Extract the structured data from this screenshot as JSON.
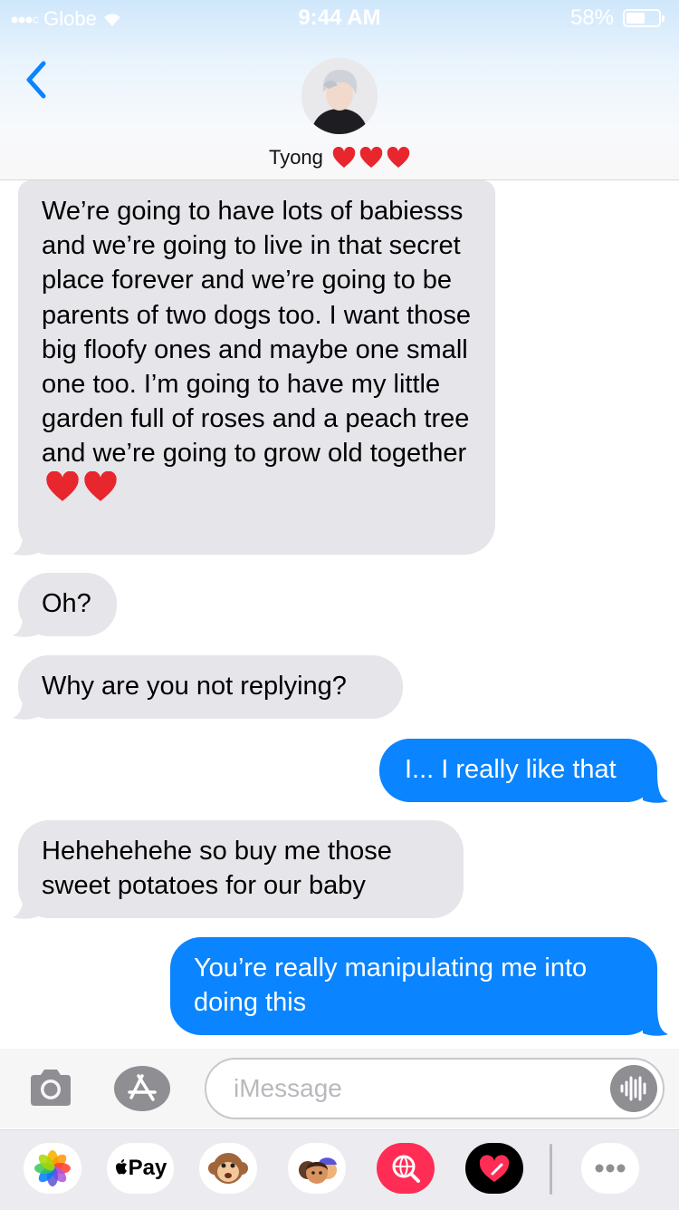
{
  "status_bar": {
    "carrier": "Globe",
    "time": "9:44 AM",
    "battery_percent": "58%",
    "battery_level": 0.58
  },
  "header": {
    "contact_name": "Tyong",
    "contact_emoji": [
      "red-heart",
      "red-heart",
      "red-heart"
    ],
    "back_icon": "chevron-left-icon",
    "accent_color": "#0a84ff"
  },
  "messages": [
    {
      "direction": "received",
      "text": "We’re going to have lots of babiesss and we’re going to live in that secret place forever and we’re going to be parents of two dogs too. I want those big floofy ones and maybe one small one too. I’m going to have my little garden full of roses and a peach tree and we’re going to grow old together",
      "trailing_emoji": [
        "red-heart",
        "red-heart"
      ]
    },
    {
      "direction": "received",
      "text": "Oh?"
    },
    {
      "direction": "received",
      "text": "Why are you not replying?"
    },
    {
      "direction": "sent",
      "text": "I... I really like that"
    },
    {
      "direction": "received",
      "text": "Hehehehehe so buy me those sweet potatoes for our baby"
    },
    {
      "direction": "sent",
      "text": "You’re really manipulating me into doing this"
    }
  ],
  "compose": {
    "placeholder": "iMessage",
    "camera_icon": "camera-icon",
    "apps_icon": "app-store-icon",
    "audio_icon": "audio-waveform-icon"
  },
  "app_drawer": {
    "apple_pay_label": "Pay",
    "apps": [
      "photos-icon",
      "apple-pay-icon",
      "monkey-animoji-icon",
      "memoji-stickers-icon",
      "web-search-icon",
      "digital-touch-icon",
      "more-icon"
    ]
  },
  "colors": {
    "received_bubble": "#e5e5ea",
    "sent_bubble": "#0a84ff"
  }
}
